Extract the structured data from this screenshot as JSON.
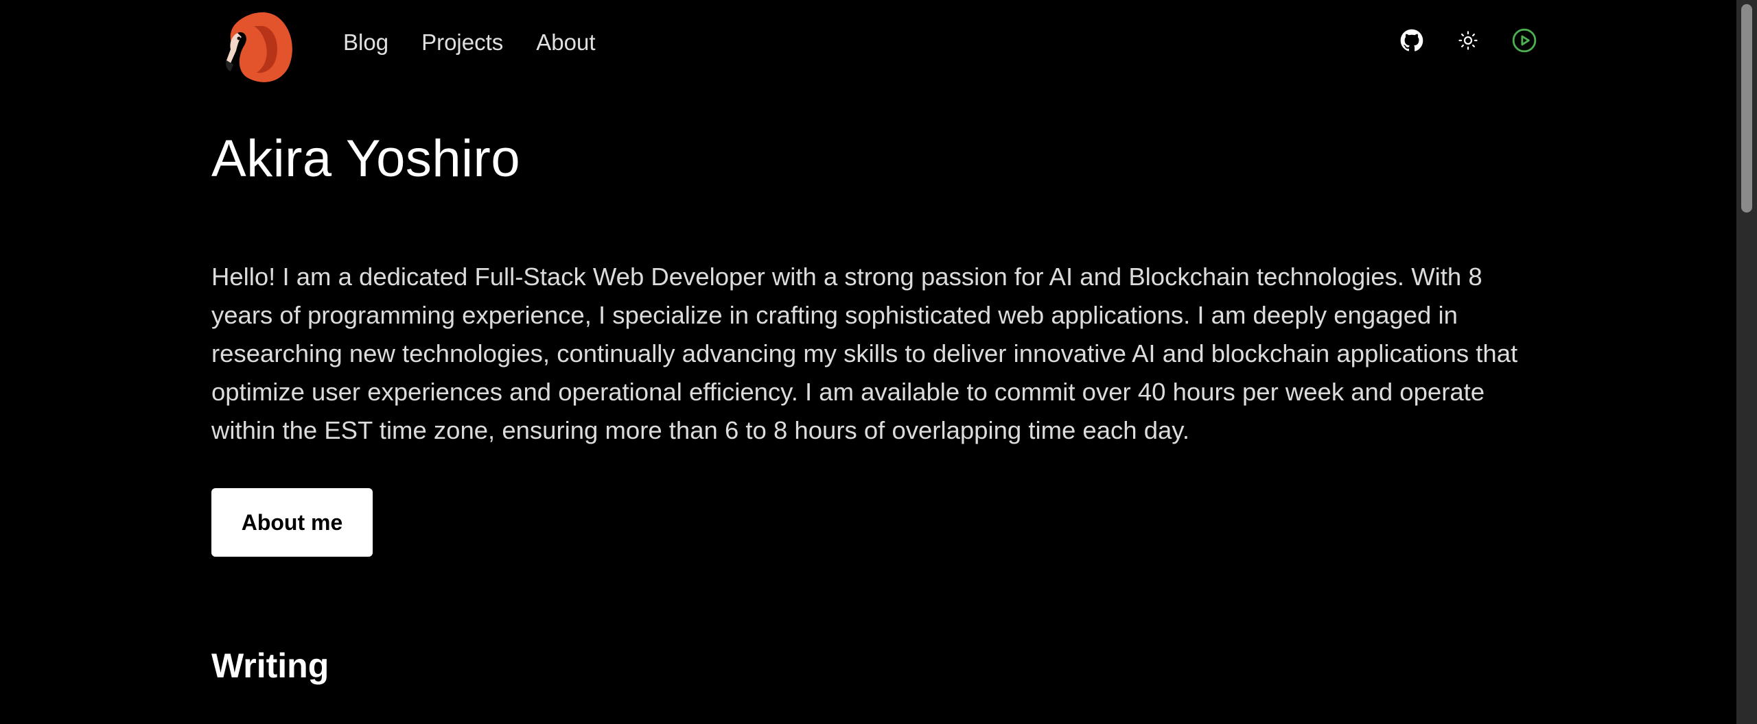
{
  "header": {
    "logo_icon": "flamingo-logo-icon",
    "nav": [
      {
        "label": "Blog"
      },
      {
        "label": "Projects"
      },
      {
        "label": "About"
      }
    ],
    "icons": {
      "github": "github-icon",
      "theme": "sun-icon",
      "play": "play-circle-icon"
    },
    "colors": {
      "play_accent": "#4caf50",
      "flamingo": "#e8552e"
    }
  },
  "main": {
    "name": "Akira Yoshiro",
    "bio": "Hello! I am a dedicated Full-Stack Web Developer with a strong passion for AI and Blockchain technologies. With 8 years of programming experience, I specialize in crafting sophisticated web applications. I am deeply engaged in researching new technologies, continually advancing my skills to deliver innovative AI and blockchain applications that optimize user experiences and operational efficiency. I am available to commit over 40 hours per week and operate within the EST time zone, ensuring more than 6 to 8 hours of overlapping time each day.",
    "about_button": "About me",
    "writing_heading": "Writing"
  },
  "colors": {
    "background": "#000000",
    "text": "#e5e5e5",
    "button_bg": "#ffffff",
    "button_text": "#000000"
  }
}
